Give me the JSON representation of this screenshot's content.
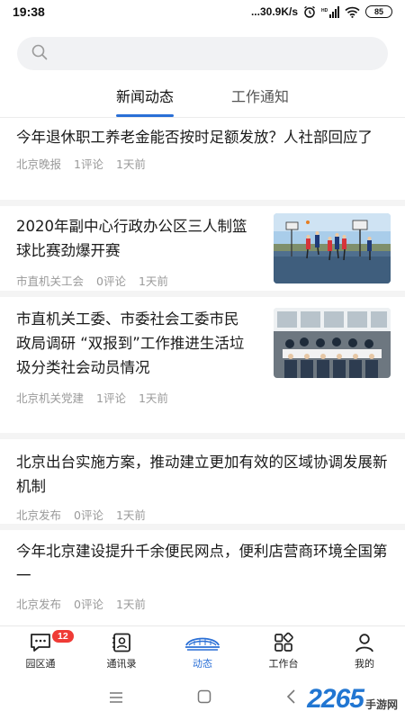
{
  "status_bar": {
    "time": "19:38",
    "network_speed": "...30.9K/s",
    "battery": "85"
  },
  "search": {
    "placeholder": ""
  },
  "tabs": [
    {
      "label": "新闻动态",
      "active": true
    },
    {
      "label": "工作通知",
      "active": false
    }
  ],
  "news": [
    {
      "title": "今年退休职工养老金能否按时足额发放？人社部回应了",
      "source": "北京晚报",
      "comments": "1评论",
      "time": "1天前",
      "image": ""
    },
    {
      "title": "2020年副中心行政办公区三人制篮球比赛劲爆开赛",
      "source": "市直机关工会",
      "comments": "0评论",
      "time": "1天前",
      "image": "basketball-photo"
    },
    {
      "title": "市直机关工委、市委社会工委市民政局调研 “双报到”工作推进生活垃圾分类社会动员情况",
      "source": "北京机关党建",
      "comments": "1评论",
      "time": "1天前",
      "image": "meeting-photo"
    },
    {
      "title": "北京出台实施方案，推动建立更加有效的区域协调发展新机制",
      "source": "北京发布",
      "comments": "0评论",
      "time": "1天前",
      "image": ""
    },
    {
      "title": "今年北京建设提升千余便民网点，便利店营商环境全国第一",
      "source": "北京发布",
      "comments": "0评论",
      "time": "1天前",
      "image": ""
    }
  ],
  "bottom_nav": [
    {
      "label": "园区通",
      "icon": "chat-icon",
      "badge": "12",
      "active": false
    },
    {
      "label": "通讯录",
      "icon": "contacts-icon",
      "active": false
    },
    {
      "label": "动态",
      "icon": "stadium-icon",
      "active": true
    },
    {
      "label": "工作台",
      "icon": "grid-icon",
      "active": false
    },
    {
      "label": "我的",
      "icon": "person-icon",
      "active": false
    }
  ],
  "watermark": {
    "number": "2265",
    "text": "手游网"
  },
  "colors": {
    "accent": "#2a6fd6",
    "badge": "#ef3b36",
    "watermark": "#2176d2"
  }
}
